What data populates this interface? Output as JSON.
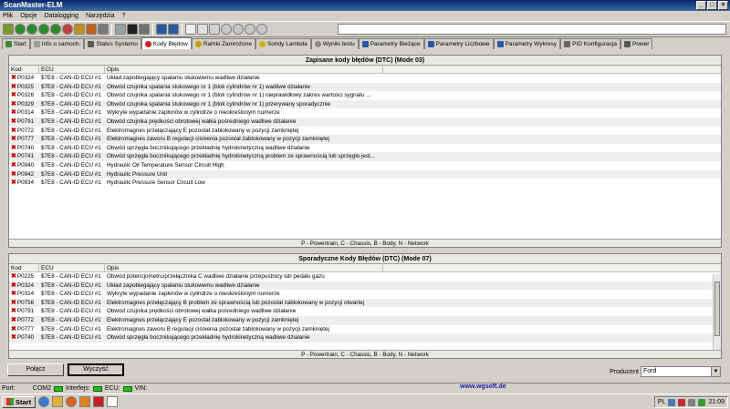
{
  "window": {
    "title": "ScanMaster-ELM"
  },
  "menu": [
    "Plik",
    "Opcje",
    "Datalogging",
    "Narzędzia",
    "?"
  ],
  "tabs": [
    {
      "label": "Start",
      "icon": "gear-icon",
      "color": "#3a8a3a"
    },
    {
      "label": "Info o samoch.",
      "icon": "info-icon",
      "color": "#9a9a9a"
    },
    {
      "label": "Status Systemu",
      "icon": "monitor-icon",
      "color": "#5a5a5a"
    },
    {
      "label": "Kody Błędów",
      "icon": "error-icon",
      "color": "#cc2222"
    },
    {
      "label": "Ramki Zamrożone",
      "icon": "snowflake-icon",
      "color": "#cc9900"
    },
    {
      "label": "Sondy Lambda",
      "icon": "lambda-icon",
      "color": "#d4b000"
    },
    {
      "label": "Wyniki testu",
      "icon": "test-icon",
      "color": "#888888"
    },
    {
      "label": "Parametry Bieżące",
      "icon": "table-icon",
      "color": "#2a5aa0"
    },
    {
      "label": "Parametry Liczbowe",
      "icon": "table-icon",
      "color": "#2a5aa0"
    },
    {
      "label": "Parametry Wykresy",
      "icon": "chart-icon",
      "color": "#2a5aa0"
    },
    {
      "label": "PID Konfiguracja",
      "icon": "config-icon",
      "color": "#666666"
    },
    {
      "label": "Power",
      "icon": "power-icon",
      "color": "#555555"
    }
  ],
  "columns": {
    "kod": "Kod",
    "ecu": "ECU",
    "opis": "Opis"
  },
  "stored": {
    "title": "Zapisane kody błędów (DTC) (Mode 03)",
    "footer": "P - Powertrain, C - Chassis, B - Body, N - Network",
    "rows": [
      {
        "kod": "P0324",
        "ecu": "$7E8 - CAN-ID ECU #1",
        "opis": "Układ zapobiegający spalaniu stukowemu wadliwe działanie"
      },
      {
        "kod": "P0325",
        "ecu": "$7E8 - CAN-ID ECU #1",
        "opis": "Obwód czujnika spalania stukowego nr 1 (blok cylindrów nr 1) wadliwe działanie"
      },
      {
        "kod": "P0326",
        "ecu": "$7E8 - CAN-ID ECU #1",
        "opis": "Obwód czujnika spalania stukowego nr 1 (blok cylindrów nr 1) nieprawidłowy zakres wartości sygnału ..."
      },
      {
        "kod": "P0329",
        "ecu": "$7E8 - CAN-ID ECU #1",
        "opis": "Obwód czujnika spalania stukowego nr 1 (blok cylindrów nr 1) przerywany sporadycznie"
      },
      {
        "kod": "P0314",
        "ecu": "$7E8 - CAN-ID ECU #1",
        "opis": "Wykryte wypadanie zapłonów w cylindrze o nieokreślonym numerze"
      },
      {
        "kod": "P0791",
        "ecu": "$7E8 - CAN-ID ECU #1",
        "opis": "Obwód czujnika prędkości obrotowej wałka pośredniego wadliwe działanie"
      },
      {
        "kod": "P0772",
        "ecu": "$7E8 - CAN-ID ECU #1",
        "opis": "Elektromagnes przełączający E pozostał zablokowany w pozycji zamkniętej"
      },
      {
        "kod": "P0777",
        "ecu": "$7E8 - CAN-ID ECU #1",
        "opis": "Elektromagnes zaworu B regulacji ciśnienia pozostał zablokowany w pozycji zamkniętej"
      },
      {
        "kod": "P0740",
        "ecu": "$7E8 - CAN-ID ECU #1",
        "opis": "Obwód sprzęgła bocznikującego przekładnię hydrokinetyczną wadliwe działanie"
      },
      {
        "kod": "P0741",
        "ecu": "$7E8 - CAN-ID ECU #1",
        "opis": "Obwód sprzęgła bocznikującego przekładnię hydrokinetyczną problem ze sprawnością lub sprzęgło jest..."
      },
      {
        "kod": "P0940",
        "ecu": "$7E8 - CAN-ID ECU #1",
        "opis": "Hydraulic Oil Temperature Sensor Circuit High"
      },
      {
        "kod": "P0942",
        "ecu": "$7E8 - CAN-ID ECU #1",
        "opis": "Hydraulic Pressure Unit"
      },
      {
        "kod": "P0934",
        "ecu": "$7E8 - CAN-ID ECU #1",
        "opis": "Hydraulic Pressure Sensor Circuit Low"
      }
    ]
  },
  "pending": {
    "title": "Sporadyczne Kody Błędów (DTC) (Mode 07)",
    "footer": "P - Powertrain, C - Chassis, B - Body, N - Network",
    "rows": [
      {
        "kod": "P0225",
        "ecu": "$7E8 - CAN-ID ECU #1",
        "opis": "Obwód potencjometru/przełącznika C wadliwe działanie przepustnicy lub pedału gazu"
      },
      {
        "kod": "P0324",
        "ecu": "$7E8 - CAN-ID ECU #1",
        "opis": "Układ zapobiegający spalaniu stukowemu wadliwe działanie"
      },
      {
        "kod": "P0314",
        "ecu": "$7E8 - CAN-ID ECU #1",
        "opis": "Wykryte wypadanie zapłonów w cylindrze o nieokreślonym numerze"
      },
      {
        "kod": "P0756",
        "ecu": "$7E8 - CAN-ID ECU #1",
        "opis": "Elektromagnes przełączający B problem ze sprawnością lub pozostał zablokowany w pozycji otwartej"
      },
      {
        "kod": "P0791",
        "ecu": "$7E8 - CAN-ID ECU #1",
        "opis": "Obwód czujnika prędkości obrotowej wałka pośredniego wadliwe działanie"
      },
      {
        "kod": "P0772",
        "ecu": "$7E8 - CAN-ID ECU #1",
        "opis": "Elektromagnes przełączający E pozostał zablokowany w pozycji zamkniętej"
      },
      {
        "kod": "P0777",
        "ecu": "$7E8 - CAN-ID ECU #1",
        "opis": "Elektromagnes zaworu B regulacji ciśnienia pozostał zablokowany w pozycji zamkniętej"
      },
      {
        "kod": "P0740",
        "ecu": "$7E8 - CAN-ID ECU #1",
        "opis": "Obwód sprzęgła bocznikującego przekładnię hydrokinetyczną wadliwe działanie"
      }
    ]
  },
  "buttons": {
    "connect": "Połącz",
    "clear": "Wyczyść"
  },
  "producent": {
    "label": "Producent",
    "value": "Ford"
  },
  "status": {
    "port_label": "Port:",
    "port_value": "COM2",
    "interface_label": "Interfejs:",
    "ecu_label": "ECU:",
    "vin_label": "VIN:",
    "url": "www.wgsoft.de"
  },
  "taskbar": {
    "start": "Start",
    "lang": "PL",
    "clock": "21:09"
  }
}
